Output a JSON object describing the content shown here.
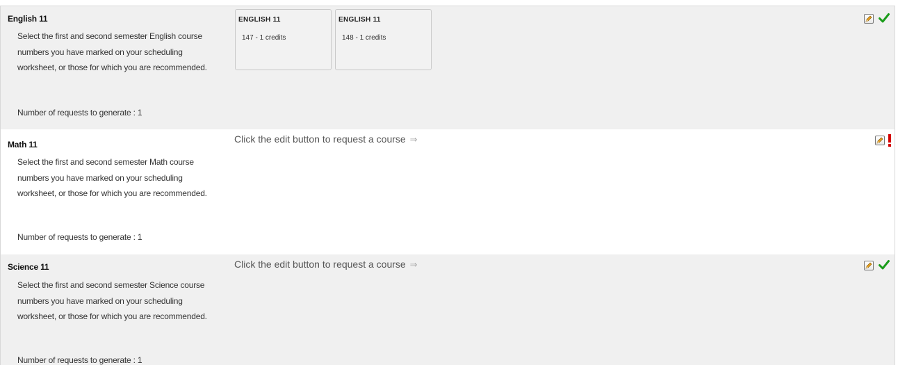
{
  "courses": [
    {
      "title": "English 11",
      "description": "Select the first and second semester English course numbers you have marked on your scheduling worksheet, or those for which you are recommended.",
      "requests_text": "Number of requests to generate : 1",
      "status": "complete",
      "selections": [
        {
          "name": "ENGLISH 11",
          "info": "147 - 1 credits"
        },
        {
          "name": "ENGLISH 11",
          "info": "148 - 1 credits"
        }
      ]
    },
    {
      "title": "Math 11",
      "description": "Select the first and second semester Math course numbers you have marked on your scheduling worksheet, or those for which you are recommended.",
      "requests_text": "Number of requests to generate : 1",
      "status": "incomplete",
      "prompt": "Click the edit button to request a course",
      "prompt_arrow": "⇒"
    },
    {
      "title": "Science 11",
      "description": "Select the first and second semester Science course numbers you have marked on your scheduling worksheet, or those for which you are recommended.",
      "requests_text": "Number of requests to generate : 1",
      "status": "complete",
      "prompt": "Click the edit button to request a course",
      "prompt_arrow": "⇒"
    }
  ],
  "icons": {
    "edit": "pencil-edit-icon",
    "complete": "checkmark-icon",
    "incomplete": "exclamation-icon"
  },
  "colors": {
    "check_green": "#1a9c1a",
    "alert_red": "#d40000",
    "pencil_orange": "#e8a020"
  }
}
